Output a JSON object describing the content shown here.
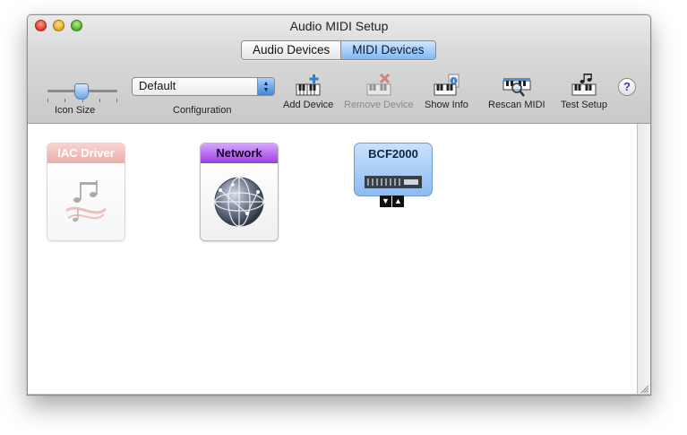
{
  "window": {
    "title": "Audio MIDI Setup"
  },
  "tabs": [
    {
      "label": "Audio Devices",
      "active": false
    },
    {
      "label": "MIDI Devices",
      "active": true
    }
  ],
  "toolbar": {
    "icon_size_label": "Icon Size",
    "configuration_label": "Configuration",
    "configuration_value": "Default",
    "add_device": "Add Device",
    "remove_device": "Remove Device",
    "show_info": "Show Info",
    "rescan_midi": "Rescan MIDI",
    "test_setup": "Test Setup",
    "help": "?"
  },
  "devices": [
    {
      "name": "IAC Driver",
      "enabled": false
    },
    {
      "name": "Network",
      "enabled": true
    },
    {
      "name": "BCF2000",
      "enabled": true
    }
  ],
  "icons": [
    "close-icon",
    "minimize-icon",
    "zoom-icon",
    "piano-plus-icon",
    "piano-x-icon",
    "piano-info-icon",
    "piano-magnifier-icon",
    "piano-notes-icon",
    "music-notes-icon",
    "globe-icon",
    "midi-controller-icon",
    "resize-grip-icon"
  ]
}
